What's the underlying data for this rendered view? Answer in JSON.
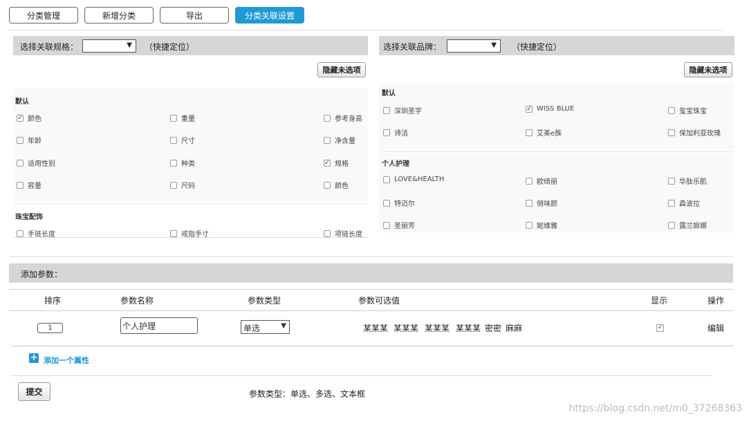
{
  "tabs": [
    {
      "label": "分类管理",
      "active": false
    },
    {
      "label": "新增分类",
      "active": false
    },
    {
      "label": "导出",
      "active": false
    },
    {
      "label": "分类关联设置",
      "active": true
    }
  ],
  "spec_panel": {
    "label": "选择关联规格：",
    "hint": "（快捷定位）",
    "hide_button": "隐藏未选项",
    "groups": [
      {
        "name": "默认",
        "items": [
          {
            "label": "颜色",
            "checked": true
          },
          {
            "label": "重量",
            "checked": false
          },
          {
            "label": "参考身高",
            "checked": false
          },
          {
            "label": "年龄",
            "checked": false
          },
          {
            "label": "尺寸",
            "checked": false
          },
          {
            "label": "净含量",
            "checked": false
          },
          {
            "label": "适用性别",
            "checked": false
          },
          {
            "label": "种类",
            "checked": false
          },
          {
            "label": "规格",
            "checked": true
          },
          {
            "label": "容量",
            "checked": false
          },
          {
            "label": "尺码",
            "checked": false
          },
          {
            "label": "颜色",
            "checked": false
          }
        ]
      },
      {
        "name": "珠宝配饰",
        "items": [
          {
            "label": "手链长度",
            "checked": false
          },
          {
            "label": "戒指手寸",
            "checked": false
          },
          {
            "label": "项链长度",
            "checked": false
          }
        ]
      }
    ]
  },
  "brand_panel": {
    "label": "选择关联品牌：",
    "hint": "（快捷定位）",
    "hide_button": "隐藏未选项",
    "groups": [
      {
        "name": "默认",
        "items": [
          {
            "label": "深圳圣宇",
            "checked": false
          },
          {
            "label": "WISS BLUE",
            "checked": true
          },
          {
            "label": "玺宝珠宝",
            "checked": false
          },
          {
            "label": "诗洁",
            "checked": false
          },
          {
            "label": "艾美e族",
            "checked": false
          },
          {
            "label": "保加利亚玫瑰",
            "checked": false
          }
        ]
      },
      {
        "name": "个人护理",
        "items": [
          {
            "label": "LOVE&HEALTH",
            "checked": false
          },
          {
            "label": "欧绮丽",
            "checked": false
          },
          {
            "label": "华肽乐肌",
            "checked": false
          },
          {
            "label": "特迈尔",
            "checked": false
          },
          {
            "label": "俏味颜",
            "checked": false
          },
          {
            "label": "森波拉",
            "checked": false
          },
          {
            "label": "圣丽芳",
            "checked": false
          },
          {
            "label": "妮维雅",
            "checked": false
          },
          {
            "label": "露兰姬娜",
            "checked": false
          }
        ]
      }
    ]
  },
  "params": {
    "title": "添加参数：",
    "headers": {
      "order": "排序",
      "name": "参数名称",
      "type": "参数类型",
      "options": "参数可选值",
      "show": "显示",
      "action": "操作"
    },
    "row": {
      "order": "1",
      "name": "个人护理",
      "type": "单选",
      "options": [
        "某某某",
        "某某某",
        "某某某",
        "某某某",
        "密密",
        "麻麻"
      ],
      "show": true,
      "action": "编辑"
    },
    "add_label": "添加一个属性",
    "submit": "提交",
    "note": "参数类型：单选、多选、文本框"
  },
  "watermark": "https://blog.csdn.net/m0_37268363",
  "colors": {
    "accent": "#1e9ad6",
    "bar": "#d6d6d6"
  }
}
